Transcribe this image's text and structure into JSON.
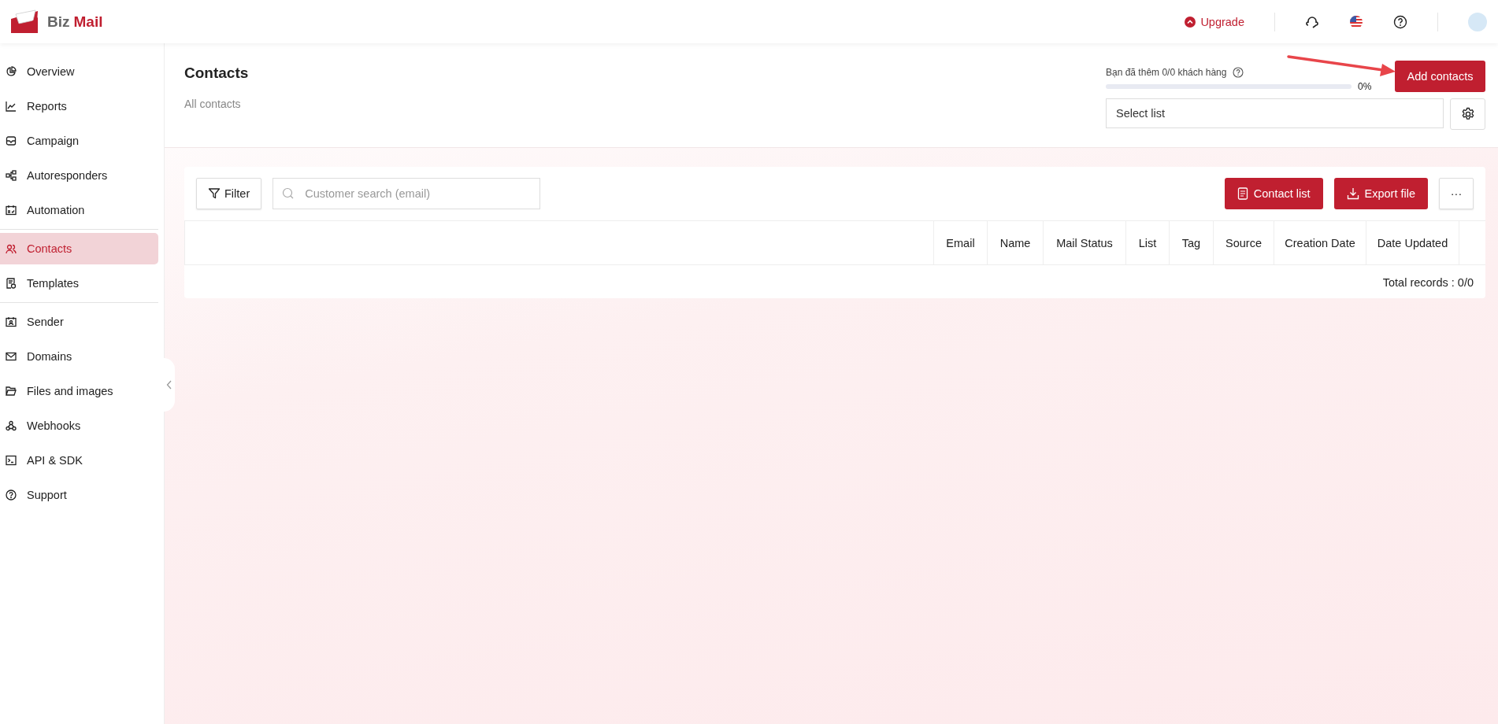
{
  "brand": {
    "first": "Biz",
    "second": "Mail"
  },
  "topbar": {
    "upgrade": "Upgrade"
  },
  "sidebar": {
    "groups": [
      [
        {
          "label": "Overview",
          "selected": false
        },
        {
          "label": "Reports",
          "selected": false
        },
        {
          "label": "Campaign",
          "selected": false
        },
        {
          "label": "Autoresponders",
          "selected": false
        },
        {
          "label": "Automation",
          "selected": false
        }
      ],
      [
        {
          "label": "Contacts",
          "selected": true
        },
        {
          "label": "Templates",
          "selected": false
        }
      ],
      [
        {
          "label": "Sender",
          "selected": false
        },
        {
          "label": "Domains",
          "selected": false
        },
        {
          "label": "Files and images",
          "selected": false
        },
        {
          "label": "Webhooks",
          "selected": false
        },
        {
          "label": "API & SDK",
          "selected": false
        },
        {
          "label": "Support",
          "selected": false
        }
      ]
    ]
  },
  "page": {
    "title": "Contacts",
    "subtitle": "All contacts"
  },
  "quota": {
    "text": "Bạn đã thêm 0/0 khách hàng",
    "level": 0,
    "reading": "0%"
  },
  "add_button": "Add contacts",
  "list_select": {
    "placeholder": "Select list"
  },
  "toolbar": {
    "filter": "Filter",
    "search": {
      "placeholder": "Customer search (email)"
    },
    "contact_list": "Contact list",
    "export": "Export file",
    "more": "···"
  },
  "table": {
    "columns": [
      "Email",
      "Name",
      "Mail Status",
      "List",
      "Tag",
      "Source",
      "Creation Date",
      "Date Updated"
    ],
    "footer": "Total records : 0/0"
  }
}
